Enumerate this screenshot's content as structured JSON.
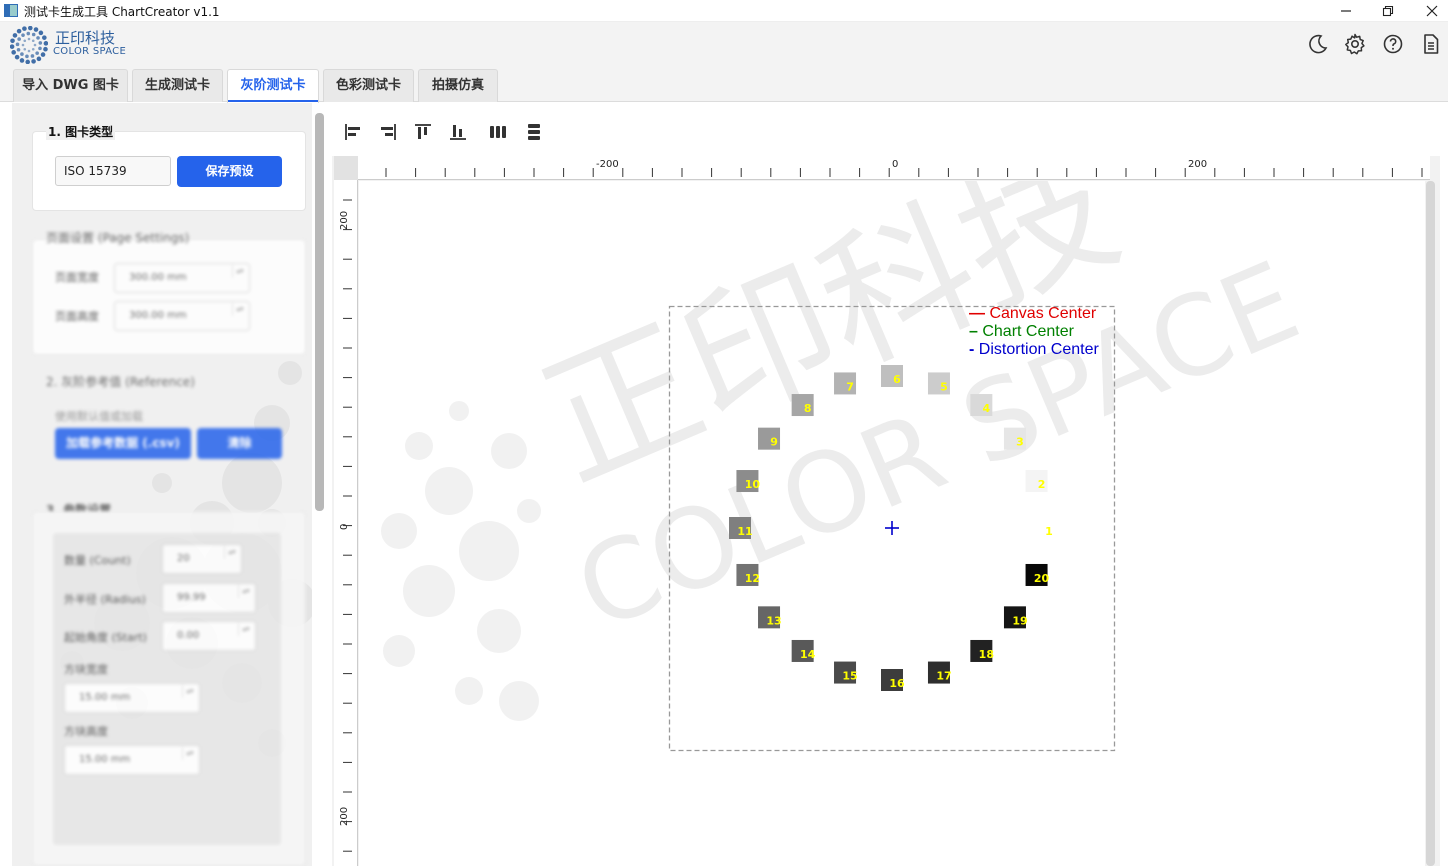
{
  "window": {
    "title": "测试卡生成工具 ChartCreator v1.1",
    "minimize_icon": "minimize-icon",
    "maximize_icon": "restore-icon",
    "close_icon": "close-icon"
  },
  "header": {
    "logo_cn": "正印科技",
    "logo_en": "COLOR SPACE",
    "icons": [
      "moon-icon",
      "gear-icon",
      "help-icon",
      "document-icon"
    ]
  },
  "tabs": [
    {
      "label": "导入 DWG 图卡"
    },
    {
      "label": "生成测试卡"
    },
    {
      "label": "灰阶测试卡",
      "active": true
    },
    {
      "label": "色彩测试卡"
    },
    {
      "label": "拍摄仿真"
    }
  ],
  "sidebar": {
    "chart_type": {
      "title": "1. 图卡类型",
      "value": "ISO 15739",
      "save_label": "保存预设"
    },
    "page_settings": {
      "title": "页面设置 (Page Settings)",
      "width_label": "页面宽度",
      "width_value": "300.00 mm",
      "height_label": "页面高度",
      "height_value": "300.00 mm"
    },
    "reference": {
      "title": "2. 灰阶参考值 (Reference)",
      "hint": "使用默认值或加载",
      "load_label": "加载参考数据 (.csv)",
      "clear_label": "清除"
    },
    "params": {
      "title": "3. 参数设置",
      "count_label": "数量 (Count)",
      "count_value": "20",
      "radius_label": "外半径 (Radius)",
      "radius_value": "99.99",
      "start_label": "起始角度 (Start)",
      "start_value": "0.00",
      "patch_w_label": "方块宽度",
      "patch_w_value": "15.00 mm",
      "patch_h_label": "方块高度",
      "patch_h_value": "15.00 mm"
    }
  },
  "toolbar": {
    "icons": [
      "align-left-icon",
      "align-right-icon",
      "align-top-icon",
      "align-bottom-icon",
      "distribute-horizontal-icon",
      "distribute-vertical-icon"
    ]
  },
  "rulers": {
    "h_labels": [
      "-200",
      "0",
      "200"
    ],
    "v_labels": [
      "200",
      "0",
      "200"
    ]
  },
  "canvas": {
    "watermark_cn": "正印科技",
    "watermark_en": "COLOR SPACE",
    "legend": [
      {
        "label": "Canvas Center",
        "color": "#e00000"
      },
      {
        "label": "Chart Center",
        "color": "#008000"
      },
      {
        "label": "Distortion Center",
        "color": "#0000cc"
      }
    ],
    "patches": [
      {
        "label": "1",
        "gray": "#ffffff"
      },
      {
        "label": "2",
        "gray": "#f4f4f4"
      },
      {
        "label": "3",
        "gray": "#e6e6e6"
      },
      {
        "label": "4",
        "gray": "#d9d9d9"
      },
      {
        "label": "5",
        "gray": "#cccccc"
      },
      {
        "label": "6",
        "gray": "#bfbfbf"
      },
      {
        "label": "7",
        "gray": "#b3b3b3"
      },
      {
        "label": "8",
        "gray": "#a6a6a6"
      },
      {
        "label": "9",
        "gray": "#9a9a9a"
      },
      {
        "label": "10",
        "gray": "#8c8c8c"
      },
      {
        "label": "11",
        "gray": "#7f7f7f"
      },
      {
        "label": "12",
        "gray": "#737373"
      },
      {
        "label": "13",
        "gray": "#666666"
      },
      {
        "label": "14",
        "gray": "#595959"
      },
      {
        "label": "15",
        "gray": "#4a4a4a"
      },
      {
        "label": "16",
        "gray": "#3c3c3c"
      },
      {
        "label": "17",
        "gray": "#2e2e2e"
      },
      {
        "label": "18",
        "gray": "#222222"
      },
      {
        "label": "19",
        "gray": "#151515"
      },
      {
        "label": "20",
        "gray": "#080808"
      }
    ]
  }
}
